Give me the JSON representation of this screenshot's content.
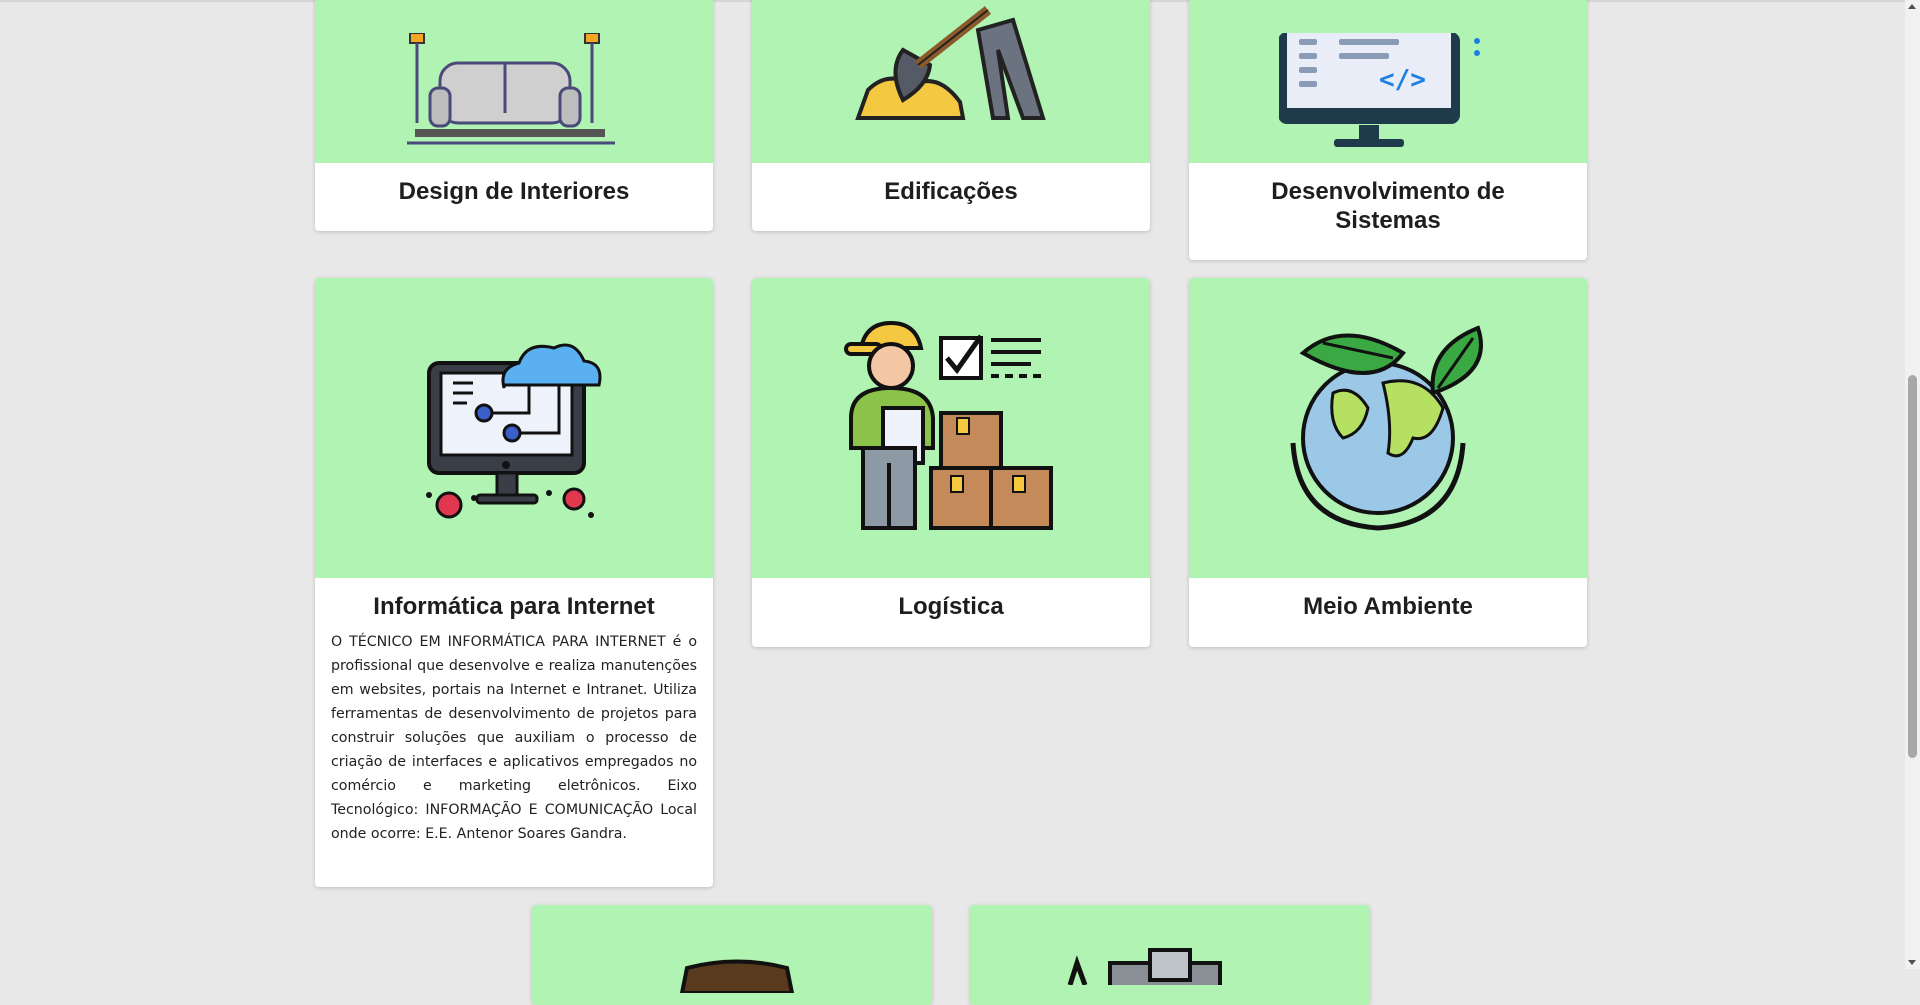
{
  "courses": [
    {
      "title": "Design de Interiores",
      "icon": "sofa-lamps-icon"
    },
    {
      "title": "Edificações",
      "icon": "construction-worker-shovel-icon"
    },
    {
      "title": "Desenvolvimento de Sistemas",
      "icon": "code-monitor-icon"
    },
    {
      "title": "Informática para Internet",
      "icon": "cloud-computer-icon",
      "description": "O TÉCNICO EM INFORMÁTICA PARA INTERNET é o profissional que desenvolve e realiza manutenções em websites, portais na Internet e Intranet. Utiliza ferramentas de desenvolvimento de projetos para construir soluções que auxiliam o processo de criação de interfaces e aplicativos empregados no comércio e marketing eletrônicos. Eixo Tecnológico: INFORMAÇÃO E COMUNICAÇÃO Local onde ocorre: E.E. Antenor Soares Gandra."
    },
    {
      "title": "Logística",
      "icon": "logistics-worker-boxes-icon"
    },
    {
      "title": "Meio Ambiente",
      "icon": "globe-leaves-icon"
    }
  ],
  "colors": {
    "page_bg": "#e8e8e8",
    "card_image_bg": "#b0f3b3",
    "card_bg": "#ffffff",
    "title_text": "#1e1e1e"
  }
}
